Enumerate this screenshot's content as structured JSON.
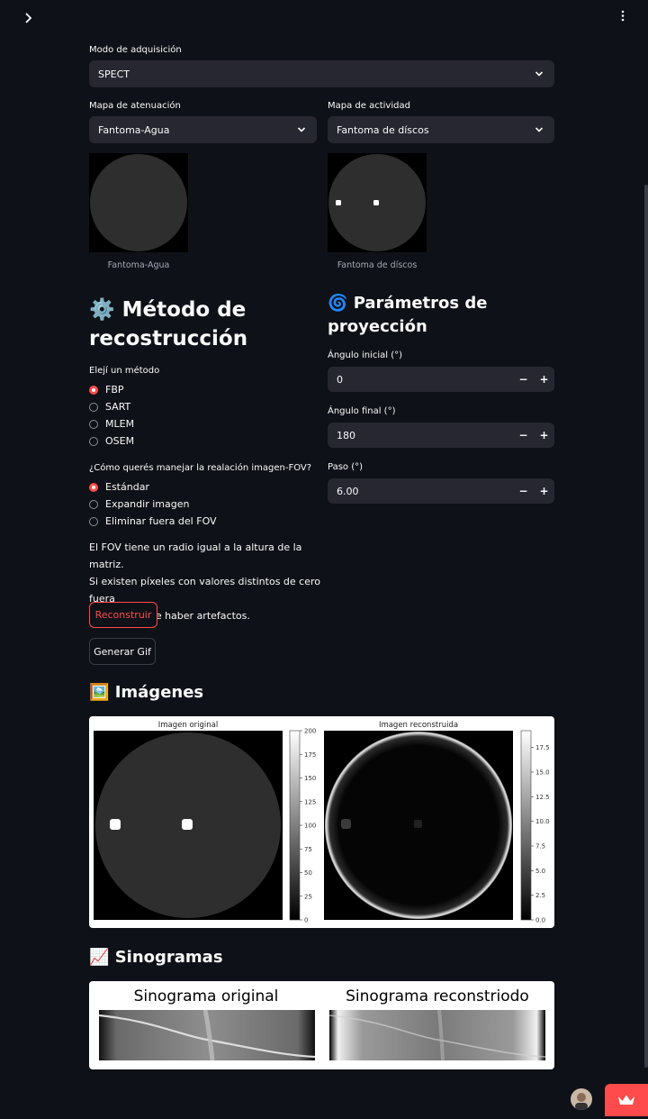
{
  "top": {
    "expand_icon": "chevron-right-icon",
    "menu_icon": "kebab-menu-icon"
  },
  "acquisition": {
    "label": "Modo de adquisición",
    "value": "SPECT"
  },
  "attenuation": {
    "label": "Mapa de atenuación",
    "value": "Fantoma-Agua",
    "caption": "Fantoma-Agua"
  },
  "activity": {
    "label": "Mapa de actividad",
    "value": "Fantoma de díscos",
    "caption": "Fantoma de díscos"
  },
  "method": {
    "emoji": "⚙️",
    "title": "Método de recostrucción",
    "label": "Elejí un método",
    "options": [
      "FBP",
      "SART",
      "MLEM",
      "OSEM"
    ],
    "selected": "FBP"
  },
  "fov": {
    "label": "¿Cómo querés manejar la realación imagen-FOV?",
    "options": [
      "Estándar",
      "Expandir imagen",
      "Eliminar fuera del FOV"
    ],
    "selected": "Estándar",
    "note": [
      "El FOV tiene un radio igual a la altura de la matriz.",
      "Si existen píxeles con valores distintos de cero fuera",
      "del FOV puede haber artefactos."
    ]
  },
  "buttons": {
    "reconstruct": "Reconstruir",
    "gif": "Generar Gif"
  },
  "projection": {
    "emoji": "🌀",
    "title": "Parámetros de proyección",
    "start": {
      "label": "Ángulo inicial (°)",
      "value": "0"
    },
    "end": {
      "label": "Ángulo final (°)",
      "value": "180"
    },
    "step": {
      "label": "Paso (°)",
      "value": "6.00"
    },
    "minus": "−",
    "plus": "+"
  },
  "images": {
    "emoji": "🖼️",
    "title": "Imágenes",
    "original_title": "Imagen original",
    "recon_title": "Imagen reconstruida",
    "original_ticks": [
      "200",
      "175",
      "150",
      "125",
      "100",
      "75",
      "50",
      "25",
      "0"
    ],
    "recon_ticks": [
      "17.5",
      "15.0",
      "12.5",
      "10.0",
      "7.5",
      "5.0",
      "2.5",
      "0.0"
    ]
  },
  "sinograms": {
    "emoji": "📈",
    "title": "Sinogramas",
    "original_title": "Sinograma original",
    "recon_title": "Sinograma reconstriodo"
  },
  "colors": {
    "accent": "#ff4b4b",
    "bg": "#0e1117",
    "widget": "#262730"
  }
}
